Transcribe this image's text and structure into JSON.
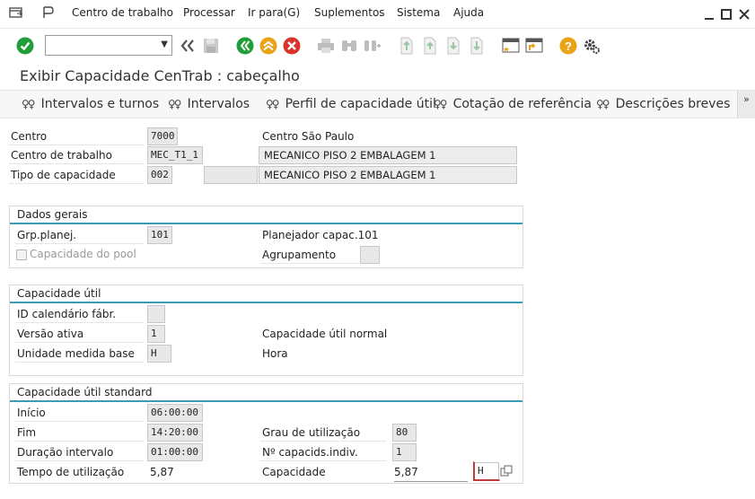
{
  "menu": {
    "items": [
      "Centro de trabalho",
      "Processar",
      "Ir para(G)",
      "Suplementos",
      "Sistema",
      "Ajuda"
    ]
  },
  "page": {
    "title": "Exibir Capacidade CenTrab : cabeçalho"
  },
  "tabs": [
    "Intervalos e turnos",
    "Intervalos",
    "Perfil de capacidade útil",
    "Cotação de referência",
    "Descrições breves"
  ],
  "header": {
    "centro_label": "Centro",
    "centro_value": "7000",
    "centro_desc": "Centro São Paulo",
    "workcenter_label": "Centro de trabalho",
    "workcenter_value": "MEC_T1_1",
    "workcenter_desc": "MECANICO PISO 2 EMBALAGEM 1",
    "captype_label": "Tipo de capacidade",
    "captype_value": "002",
    "captype_desc": "MECANICO PISO 2 EMBALAGEM 1"
  },
  "general": {
    "title": "Dados gerais",
    "grp_label": "Grp.planej.",
    "grp_value": "101",
    "grp_desc": "Planejador capac.101",
    "pool_label": "Capacidade do pool",
    "agrup_label": "Agrupamento"
  },
  "util": {
    "title": "Capacidade útil",
    "calendar_label": "ID calendário fábr.",
    "version_label": "Versão ativa",
    "version_value": "1",
    "version_desc": "Capacidade útil normal",
    "unit_label": "Unidade medida base",
    "unit_value": "H",
    "unit_desc": "Hora"
  },
  "standard": {
    "title": "Capacidade útil standard",
    "inicio_label": "Início",
    "inicio_value": "06:00:00",
    "fim_label": "Fim",
    "fim_value": "14:20:00",
    "duracao_label": "Duração intervalo",
    "duracao_value": "01:00:00",
    "tempo_label": "Tempo de utilização",
    "tempo_value": "5,87",
    "grau_label": "Grau de utilização",
    "grau_value": "80",
    "capind_label": "Nº capacids.indiv.",
    "capind_value": "1",
    "capacidade_label": "Capacidade",
    "capacidade_value": "5,87",
    "capacidade_unit": "H"
  },
  "colors": {
    "accent_line": "#3a9bb4",
    "enter_green": "#1f9e3a",
    "cancel_red": "#d9342b",
    "exit_yellow": "#e8a317"
  },
  "icons": [
    "menu-icon",
    "help-icon",
    "enter-icon",
    "back-arrows-icon",
    "save-icon",
    "back-icon",
    "exit-icon",
    "cancel-icon",
    "print-icon",
    "find-icon",
    "find-next-icon",
    "first-page-icon",
    "prev-page-icon",
    "next-page-icon",
    "last-page-icon",
    "create-session-icon",
    "shortcut-icon",
    "help-icon",
    "settings-icon",
    "glasses-icon",
    "expand-icon",
    "minimize-icon",
    "maximize-icon",
    "close-icon"
  ]
}
